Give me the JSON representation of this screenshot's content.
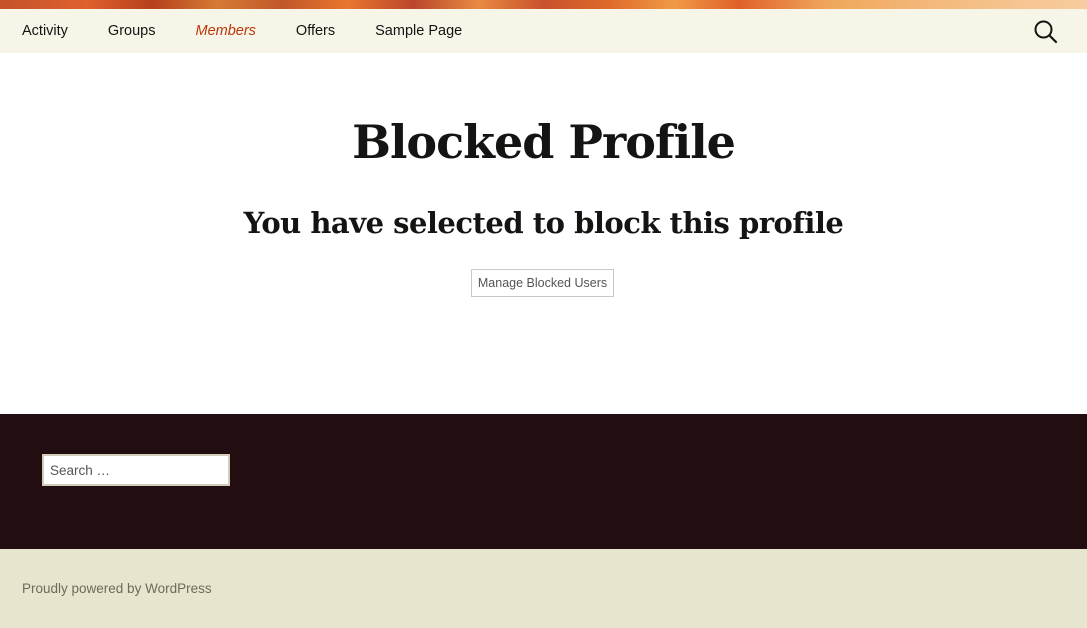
{
  "header": {
    "nav_items": [
      {
        "label": "Activity",
        "active": false
      },
      {
        "label": "Groups",
        "active": false
      },
      {
        "label": "Members",
        "active": true
      },
      {
        "label": "Offers",
        "active": false
      },
      {
        "label": "Sample Page",
        "active": false
      }
    ],
    "search_icon": "search-icon"
  },
  "main": {
    "title": "Blocked Profile",
    "subtitle": "You have selected to block this profile",
    "manage_button_label": "Manage Blocked Users"
  },
  "footer": {
    "search_placeholder": "Search …",
    "credit": "Proudly powered by WordPress"
  },
  "colors": {
    "nav_background": "#f7f5e7",
    "active_link": "#bc360a",
    "footer_widgets_background": "#220e10",
    "site_info_background": "#e8e5ce"
  }
}
